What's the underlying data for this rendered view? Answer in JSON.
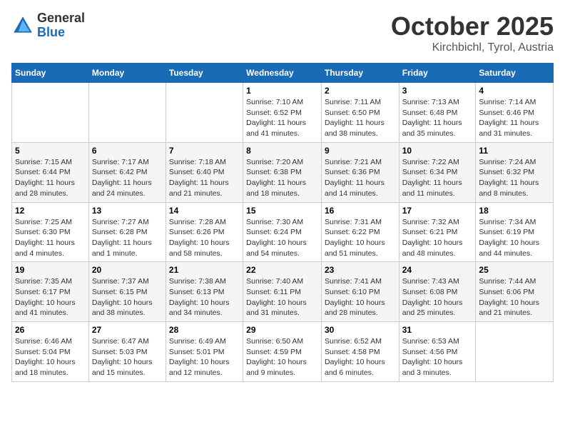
{
  "header": {
    "logo_general": "General",
    "logo_blue": "Blue",
    "month_title": "October 2025",
    "location": "Kirchbichl, Tyrol, Austria"
  },
  "days_of_week": [
    "Sunday",
    "Monday",
    "Tuesday",
    "Wednesday",
    "Thursday",
    "Friday",
    "Saturday"
  ],
  "weeks": [
    [
      {
        "day": "",
        "info": ""
      },
      {
        "day": "",
        "info": ""
      },
      {
        "day": "",
        "info": ""
      },
      {
        "day": "1",
        "info": "Sunrise: 7:10 AM\nSunset: 6:52 PM\nDaylight: 11 hours and 41 minutes."
      },
      {
        "day": "2",
        "info": "Sunrise: 7:11 AM\nSunset: 6:50 PM\nDaylight: 11 hours and 38 minutes."
      },
      {
        "day": "3",
        "info": "Sunrise: 7:13 AM\nSunset: 6:48 PM\nDaylight: 11 hours and 35 minutes."
      },
      {
        "day": "4",
        "info": "Sunrise: 7:14 AM\nSunset: 6:46 PM\nDaylight: 11 hours and 31 minutes."
      }
    ],
    [
      {
        "day": "5",
        "info": "Sunrise: 7:15 AM\nSunset: 6:44 PM\nDaylight: 11 hours and 28 minutes."
      },
      {
        "day": "6",
        "info": "Sunrise: 7:17 AM\nSunset: 6:42 PM\nDaylight: 11 hours and 24 minutes."
      },
      {
        "day": "7",
        "info": "Sunrise: 7:18 AM\nSunset: 6:40 PM\nDaylight: 11 hours and 21 minutes."
      },
      {
        "day": "8",
        "info": "Sunrise: 7:20 AM\nSunset: 6:38 PM\nDaylight: 11 hours and 18 minutes."
      },
      {
        "day": "9",
        "info": "Sunrise: 7:21 AM\nSunset: 6:36 PM\nDaylight: 11 hours and 14 minutes."
      },
      {
        "day": "10",
        "info": "Sunrise: 7:22 AM\nSunset: 6:34 PM\nDaylight: 11 hours and 11 minutes."
      },
      {
        "day": "11",
        "info": "Sunrise: 7:24 AM\nSunset: 6:32 PM\nDaylight: 11 hours and 8 minutes."
      }
    ],
    [
      {
        "day": "12",
        "info": "Sunrise: 7:25 AM\nSunset: 6:30 PM\nDaylight: 11 hours and 4 minutes."
      },
      {
        "day": "13",
        "info": "Sunrise: 7:27 AM\nSunset: 6:28 PM\nDaylight: 11 hours and 1 minute."
      },
      {
        "day": "14",
        "info": "Sunrise: 7:28 AM\nSunset: 6:26 PM\nDaylight: 10 hours and 58 minutes."
      },
      {
        "day": "15",
        "info": "Sunrise: 7:30 AM\nSunset: 6:24 PM\nDaylight: 10 hours and 54 minutes."
      },
      {
        "day": "16",
        "info": "Sunrise: 7:31 AM\nSunset: 6:22 PM\nDaylight: 10 hours and 51 minutes."
      },
      {
        "day": "17",
        "info": "Sunrise: 7:32 AM\nSunset: 6:21 PM\nDaylight: 10 hours and 48 minutes."
      },
      {
        "day": "18",
        "info": "Sunrise: 7:34 AM\nSunset: 6:19 PM\nDaylight: 10 hours and 44 minutes."
      }
    ],
    [
      {
        "day": "19",
        "info": "Sunrise: 7:35 AM\nSunset: 6:17 PM\nDaylight: 10 hours and 41 minutes."
      },
      {
        "day": "20",
        "info": "Sunrise: 7:37 AM\nSunset: 6:15 PM\nDaylight: 10 hours and 38 minutes."
      },
      {
        "day": "21",
        "info": "Sunrise: 7:38 AM\nSunset: 6:13 PM\nDaylight: 10 hours and 34 minutes."
      },
      {
        "day": "22",
        "info": "Sunrise: 7:40 AM\nSunset: 6:11 PM\nDaylight: 10 hours and 31 minutes."
      },
      {
        "day": "23",
        "info": "Sunrise: 7:41 AM\nSunset: 6:10 PM\nDaylight: 10 hours and 28 minutes."
      },
      {
        "day": "24",
        "info": "Sunrise: 7:43 AM\nSunset: 6:08 PM\nDaylight: 10 hours and 25 minutes."
      },
      {
        "day": "25",
        "info": "Sunrise: 7:44 AM\nSunset: 6:06 PM\nDaylight: 10 hours and 21 minutes."
      }
    ],
    [
      {
        "day": "26",
        "info": "Sunrise: 6:46 AM\nSunset: 5:04 PM\nDaylight: 10 hours and 18 minutes."
      },
      {
        "day": "27",
        "info": "Sunrise: 6:47 AM\nSunset: 5:03 PM\nDaylight: 10 hours and 15 minutes."
      },
      {
        "day": "28",
        "info": "Sunrise: 6:49 AM\nSunset: 5:01 PM\nDaylight: 10 hours and 12 minutes."
      },
      {
        "day": "29",
        "info": "Sunrise: 6:50 AM\nSunset: 4:59 PM\nDaylight: 10 hours and 9 minutes."
      },
      {
        "day": "30",
        "info": "Sunrise: 6:52 AM\nSunset: 4:58 PM\nDaylight: 10 hours and 6 minutes."
      },
      {
        "day": "31",
        "info": "Sunrise: 6:53 AM\nSunset: 4:56 PM\nDaylight: 10 hours and 3 minutes."
      },
      {
        "day": "",
        "info": ""
      }
    ]
  ]
}
